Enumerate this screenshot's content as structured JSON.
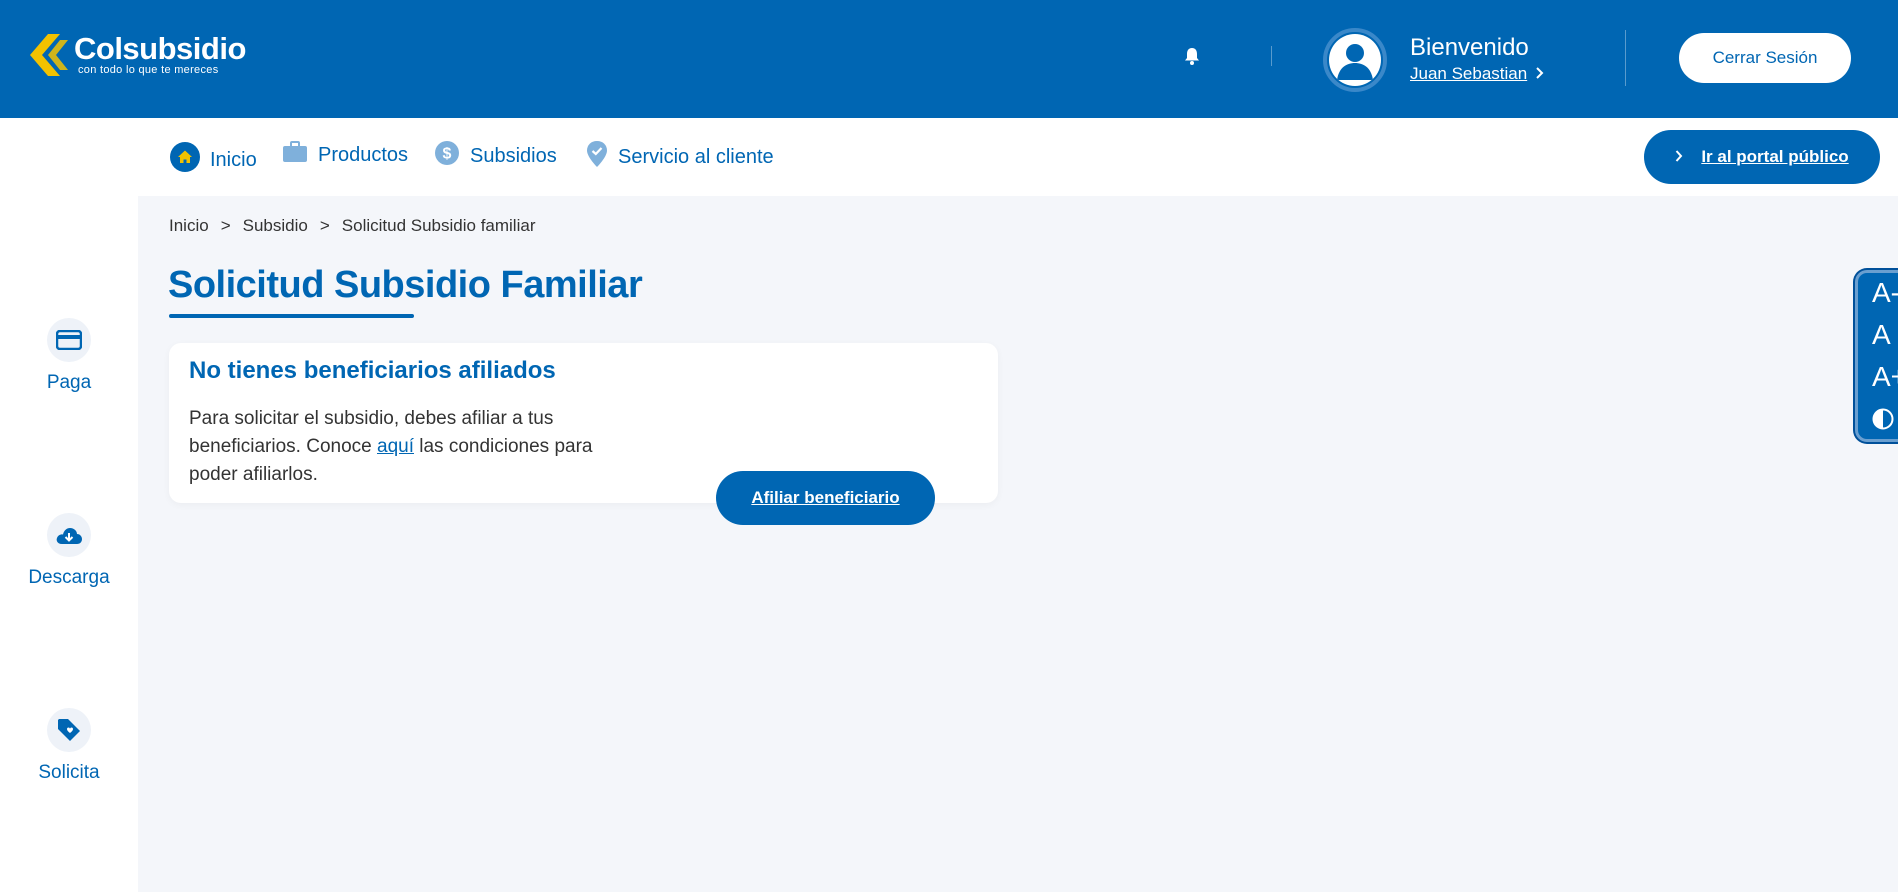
{
  "header": {
    "logo_name": "Colsubsidio",
    "logo_tagline": "con todo lo que te mereces",
    "welcome": "Bienvenido",
    "username": "Juan Sebastian",
    "logout_label": "Cerrar Sesión"
  },
  "sidebar": {
    "items": [
      {
        "label": "Paga",
        "icon": "card-icon"
      },
      {
        "label": "Descarga",
        "icon": "cloud-download-icon"
      },
      {
        "label": "Solicita",
        "icon": "tag-heart-icon"
      }
    ]
  },
  "nav": {
    "items": [
      {
        "label": "Inicio",
        "icon": "home-icon"
      },
      {
        "label": "Productos",
        "icon": "briefcase-icon"
      },
      {
        "label": "Subsidios",
        "icon": "dollar-icon"
      },
      {
        "label": "Servicio al cliente",
        "icon": "location-check-icon"
      }
    ],
    "portal_label": "Ir al portal público"
  },
  "breadcrumb": {
    "items": [
      "Inicio",
      "Subsidio",
      "Solicitud Subsidio familiar"
    ],
    "separator": ">"
  },
  "page": {
    "title": "Solicitud Subsidio Familiar"
  },
  "card": {
    "title": "No tienes beneficiarios afiliados",
    "text_before": "Para solicitar el subsidio, debes afiliar a tus beneficiarios. Conoce ",
    "link": "aquí",
    "text_after": " las condiciones para poder afiliarlos.",
    "button_label": "Afiliar beneficiario"
  },
  "accessibility": {
    "decrease": "A-",
    "normal": "A",
    "increase": "A+"
  },
  "colors": {
    "brand": "#0066b3",
    "accent": "#f2c200",
    "background": "#f4f6fa"
  }
}
